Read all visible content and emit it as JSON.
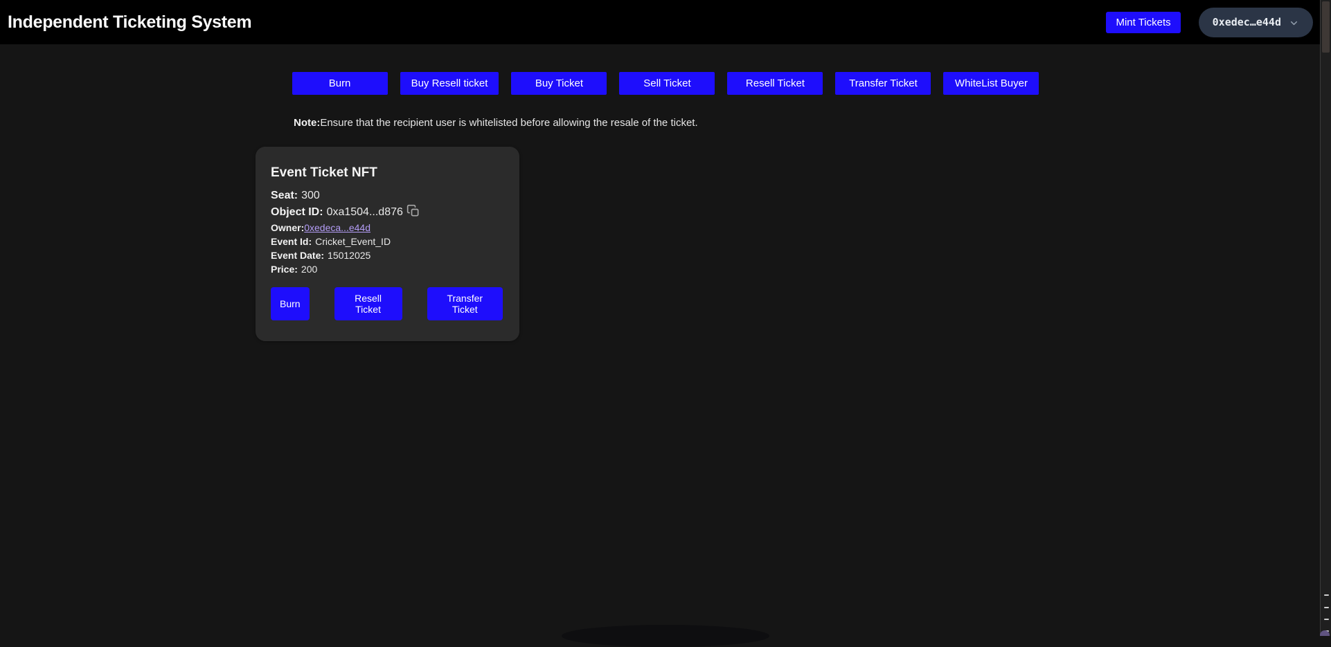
{
  "colors": {
    "accent": "#1e0efc",
    "header-bg": "#000000",
    "page-bg": "#151515",
    "card-bg": "#2b2b2b",
    "wallet-pill-bg": "#2b3546",
    "link": "#b49df6"
  },
  "header": {
    "title": "Independent Ticketing System",
    "mint_button_label": "Mint Tickets",
    "wallet_address": "0xedec…e44d"
  },
  "actions": [
    "Burn",
    "Buy Resell ticket",
    "Buy Ticket",
    "Sell Ticket",
    "Resell Ticket",
    "Transfer Ticket",
    "WhiteList Buyer"
  ],
  "note": {
    "label": "Note:",
    "text": "Ensure that the recipient user is whitelisted before allowing the resale of the ticket."
  },
  "ticket_card": {
    "title": "Event Ticket NFT",
    "seat_label": "Seat:",
    "seat_value": "300",
    "object_id_label": "Object ID:",
    "object_id_value": "0xa1504...d876",
    "copy_icon": "copy-icon",
    "owner_label": "Owner:",
    "owner_value": "0xedeca...e44d",
    "event_id_label": "Event Id:",
    "event_id_value": "Cricket_Event_ID",
    "event_date_label": "Event Date:",
    "event_date_value": "15012025",
    "price_label": "Price:",
    "price_value": "200",
    "buttons": [
      "Burn",
      "Resell Ticket",
      "Transfer Ticket"
    ]
  }
}
